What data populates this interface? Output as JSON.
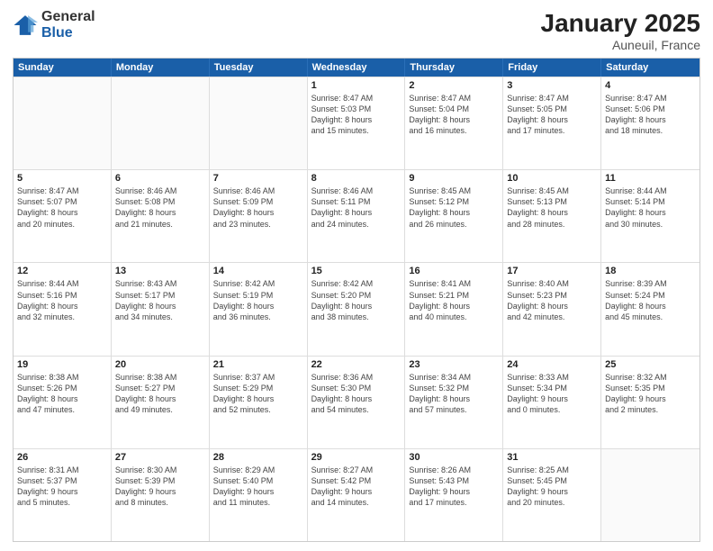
{
  "logo": {
    "general": "General",
    "blue": "Blue"
  },
  "header": {
    "title": "January 2025",
    "subtitle": "Auneuil, France"
  },
  "weekdays": [
    "Sunday",
    "Monday",
    "Tuesday",
    "Wednesday",
    "Thursday",
    "Friday",
    "Saturday"
  ],
  "weeks": [
    [
      {
        "day": "",
        "lines": []
      },
      {
        "day": "",
        "lines": []
      },
      {
        "day": "",
        "lines": []
      },
      {
        "day": "1",
        "lines": [
          "Sunrise: 8:47 AM",
          "Sunset: 5:03 PM",
          "Daylight: 8 hours",
          "and 15 minutes."
        ]
      },
      {
        "day": "2",
        "lines": [
          "Sunrise: 8:47 AM",
          "Sunset: 5:04 PM",
          "Daylight: 8 hours",
          "and 16 minutes."
        ]
      },
      {
        "day": "3",
        "lines": [
          "Sunrise: 8:47 AM",
          "Sunset: 5:05 PM",
          "Daylight: 8 hours",
          "and 17 minutes."
        ]
      },
      {
        "day": "4",
        "lines": [
          "Sunrise: 8:47 AM",
          "Sunset: 5:06 PM",
          "Daylight: 8 hours",
          "and 18 minutes."
        ]
      }
    ],
    [
      {
        "day": "5",
        "lines": [
          "Sunrise: 8:47 AM",
          "Sunset: 5:07 PM",
          "Daylight: 8 hours",
          "and 20 minutes."
        ]
      },
      {
        "day": "6",
        "lines": [
          "Sunrise: 8:46 AM",
          "Sunset: 5:08 PM",
          "Daylight: 8 hours",
          "and 21 minutes."
        ]
      },
      {
        "day": "7",
        "lines": [
          "Sunrise: 8:46 AM",
          "Sunset: 5:09 PM",
          "Daylight: 8 hours",
          "and 23 minutes."
        ]
      },
      {
        "day": "8",
        "lines": [
          "Sunrise: 8:46 AM",
          "Sunset: 5:11 PM",
          "Daylight: 8 hours",
          "and 24 minutes."
        ]
      },
      {
        "day": "9",
        "lines": [
          "Sunrise: 8:45 AM",
          "Sunset: 5:12 PM",
          "Daylight: 8 hours",
          "and 26 minutes."
        ]
      },
      {
        "day": "10",
        "lines": [
          "Sunrise: 8:45 AM",
          "Sunset: 5:13 PM",
          "Daylight: 8 hours",
          "and 28 minutes."
        ]
      },
      {
        "day": "11",
        "lines": [
          "Sunrise: 8:44 AM",
          "Sunset: 5:14 PM",
          "Daylight: 8 hours",
          "and 30 minutes."
        ]
      }
    ],
    [
      {
        "day": "12",
        "lines": [
          "Sunrise: 8:44 AM",
          "Sunset: 5:16 PM",
          "Daylight: 8 hours",
          "and 32 minutes."
        ]
      },
      {
        "day": "13",
        "lines": [
          "Sunrise: 8:43 AM",
          "Sunset: 5:17 PM",
          "Daylight: 8 hours",
          "and 34 minutes."
        ]
      },
      {
        "day": "14",
        "lines": [
          "Sunrise: 8:42 AM",
          "Sunset: 5:19 PM",
          "Daylight: 8 hours",
          "and 36 minutes."
        ]
      },
      {
        "day": "15",
        "lines": [
          "Sunrise: 8:42 AM",
          "Sunset: 5:20 PM",
          "Daylight: 8 hours",
          "and 38 minutes."
        ]
      },
      {
        "day": "16",
        "lines": [
          "Sunrise: 8:41 AM",
          "Sunset: 5:21 PM",
          "Daylight: 8 hours",
          "and 40 minutes."
        ]
      },
      {
        "day": "17",
        "lines": [
          "Sunrise: 8:40 AM",
          "Sunset: 5:23 PM",
          "Daylight: 8 hours",
          "and 42 minutes."
        ]
      },
      {
        "day": "18",
        "lines": [
          "Sunrise: 8:39 AM",
          "Sunset: 5:24 PM",
          "Daylight: 8 hours",
          "and 45 minutes."
        ]
      }
    ],
    [
      {
        "day": "19",
        "lines": [
          "Sunrise: 8:38 AM",
          "Sunset: 5:26 PM",
          "Daylight: 8 hours",
          "and 47 minutes."
        ]
      },
      {
        "day": "20",
        "lines": [
          "Sunrise: 8:38 AM",
          "Sunset: 5:27 PM",
          "Daylight: 8 hours",
          "and 49 minutes."
        ]
      },
      {
        "day": "21",
        "lines": [
          "Sunrise: 8:37 AM",
          "Sunset: 5:29 PM",
          "Daylight: 8 hours",
          "and 52 minutes."
        ]
      },
      {
        "day": "22",
        "lines": [
          "Sunrise: 8:36 AM",
          "Sunset: 5:30 PM",
          "Daylight: 8 hours",
          "and 54 minutes."
        ]
      },
      {
        "day": "23",
        "lines": [
          "Sunrise: 8:34 AM",
          "Sunset: 5:32 PM",
          "Daylight: 8 hours",
          "and 57 minutes."
        ]
      },
      {
        "day": "24",
        "lines": [
          "Sunrise: 8:33 AM",
          "Sunset: 5:34 PM",
          "Daylight: 9 hours",
          "and 0 minutes."
        ]
      },
      {
        "day": "25",
        "lines": [
          "Sunrise: 8:32 AM",
          "Sunset: 5:35 PM",
          "Daylight: 9 hours",
          "and 2 minutes."
        ]
      }
    ],
    [
      {
        "day": "26",
        "lines": [
          "Sunrise: 8:31 AM",
          "Sunset: 5:37 PM",
          "Daylight: 9 hours",
          "and 5 minutes."
        ]
      },
      {
        "day": "27",
        "lines": [
          "Sunrise: 8:30 AM",
          "Sunset: 5:39 PM",
          "Daylight: 9 hours",
          "and 8 minutes."
        ]
      },
      {
        "day": "28",
        "lines": [
          "Sunrise: 8:29 AM",
          "Sunset: 5:40 PM",
          "Daylight: 9 hours",
          "and 11 minutes."
        ]
      },
      {
        "day": "29",
        "lines": [
          "Sunrise: 8:27 AM",
          "Sunset: 5:42 PM",
          "Daylight: 9 hours",
          "and 14 minutes."
        ]
      },
      {
        "day": "30",
        "lines": [
          "Sunrise: 8:26 AM",
          "Sunset: 5:43 PM",
          "Daylight: 9 hours",
          "and 17 minutes."
        ]
      },
      {
        "day": "31",
        "lines": [
          "Sunrise: 8:25 AM",
          "Sunset: 5:45 PM",
          "Daylight: 9 hours",
          "and 20 minutes."
        ]
      },
      {
        "day": "",
        "lines": []
      }
    ]
  ]
}
